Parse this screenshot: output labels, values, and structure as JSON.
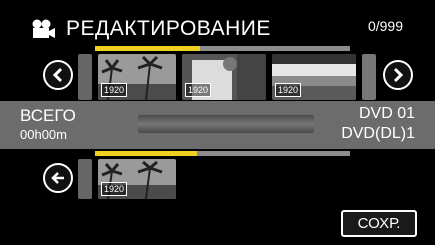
{
  "header": {
    "title": "РЕДАКТИРОВАНИЕ",
    "counter": "0/999",
    "mode_icon": "movie-camera-icon"
  },
  "top_strip": {
    "progress_fraction": 0.41,
    "thumbnails": [
      {
        "badge": "1920",
        "scene": "palms"
      },
      {
        "badge": "1920",
        "scene": "person"
      },
      {
        "badge": "1920",
        "scene": "beach"
      }
    ],
    "prev_icon": "chevron-left-icon",
    "next_icon": "chevron-right-icon"
  },
  "info": {
    "total_label": "ВСЕГО",
    "total_time": "00h00m",
    "dvd_line1": "DVD  01",
    "dvd_line2": "DVD(DL)1"
  },
  "bottom_strip": {
    "progress_fraction": 0.4,
    "thumbnails": [
      {
        "badge": "1920",
        "scene": "palms"
      }
    ],
    "back_icon": "arrow-left-icon"
  },
  "footer": {
    "save_label": "СОХР."
  }
}
